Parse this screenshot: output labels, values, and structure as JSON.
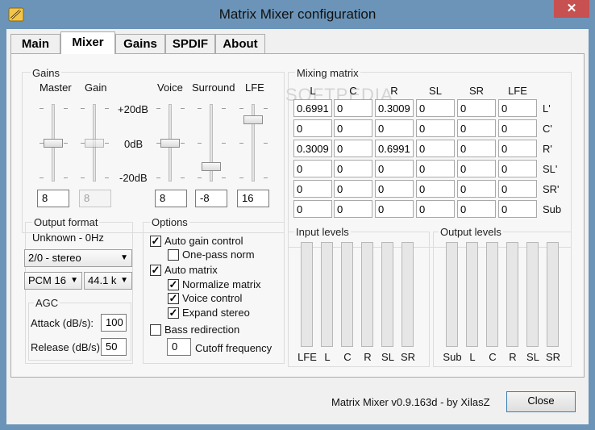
{
  "window": {
    "title": "Matrix Mixer configuration",
    "close_glyph": "✕"
  },
  "tabs": [
    "Main",
    "Mixer",
    "Gains",
    "SPDIF",
    "About"
  ],
  "gains": {
    "title": "Gains",
    "sliders": [
      {
        "label": "Master",
        "value": "8",
        "enabled": true,
        "level": 0.5
      },
      {
        "label": "Gain",
        "value": "8",
        "enabled": false,
        "level": 0.5
      },
      {
        "label": "Voice",
        "value": "8",
        "enabled": true,
        "level": 0.5
      },
      {
        "label": "Surround",
        "value": "-8",
        "enabled": true,
        "level": 0.16
      },
      {
        "label": "LFE",
        "value": "16",
        "enabled": true,
        "level": 0.84
      }
    ],
    "scale": [
      "+20dB",
      "0dB",
      "-20dB"
    ]
  },
  "output_format": {
    "title": "Output format",
    "status": "Unknown - 0Hz",
    "channel_select": "2/0 - stereo",
    "sample_format_select": "PCM 16",
    "rate_select": "44.1 k"
  },
  "agc": {
    "title": "AGC",
    "attack_label": "Attack (dB/s):",
    "attack_value": "100",
    "release_label": "Release (dB/s):",
    "release_value": "50"
  },
  "options": {
    "title": "Options",
    "auto_gain": {
      "label": "Auto gain control",
      "checked": true
    },
    "one_pass": {
      "label": "One-pass norm",
      "checked": false
    },
    "auto_matrix": {
      "label": "Auto matrix",
      "checked": true
    },
    "normalize": {
      "label": "Normalize matrix",
      "checked": true
    },
    "voice_control": {
      "label": "Voice control",
      "checked": true
    },
    "expand_stereo": {
      "label": "Expand stereo",
      "checked": true
    },
    "bass_redirection": {
      "label": "Bass redirection",
      "checked": false
    },
    "cutoff_value": "0",
    "cutoff_label": "Cutoff frequency"
  },
  "matrix": {
    "title": "Mixing matrix",
    "columns": [
      "L",
      "C",
      "R",
      "SL",
      "SR",
      "LFE"
    ],
    "rows": [
      {
        "label": "L'",
        "values": [
          "0.6991",
          "0",
          "0.3009",
          "0",
          "0",
          "0"
        ]
      },
      {
        "label": "C'",
        "values": [
          "0",
          "0",
          "0",
          "0",
          "0",
          "0"
        ]
      },
      {
        "label": "R'",
        "values": [
          "0.3009",
          "0",
          "0.6991",
          "0",
          "0",
          "0"
        ]
      },
      {
        "label": "SL'",
        "values": [
          "0",
          "0",
          "0",
          "0",
          "0",
          "0"
        ]
      },
      {
        "label": "SR'",
        "values": [
          "0",
          "0",
          "0",
          "0",
          "0",
          "0"
        ]
      },
      {
        "label": "Sub",
        "values": [
          "0",
          "0",
          "0",
          "0",
          "0",
          "0"
        ]
      }
    ]
  },
  "input_levels": {
    "title": "Input levels",
    "channels": [
      "LFE",
      "L",
      "C",
      "R",
      "SL",
      "SR"
    ]
  },
  "output_levels": {
    "title": "Output levels",
    "channels": [
      "Sub",
      "L",
      "C",
      "R",
      "SL",
      "SR"
    ]
  },
  "watermark": "SOFTPEDIA",
  "footer": {
    "version": "Matrix Mixer v0.9.163d -  by XilasZ",
    "close_label": "Close"
  }
}
